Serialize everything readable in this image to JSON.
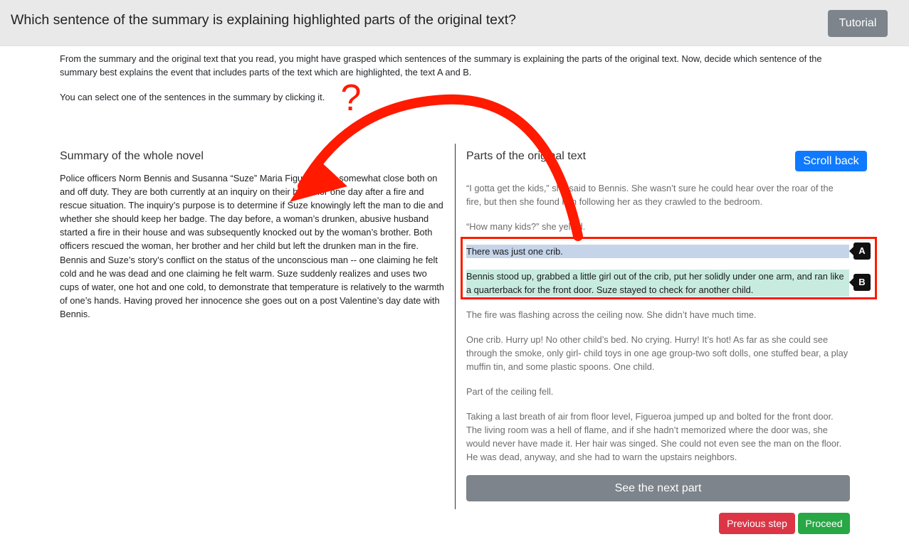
{
  "header": {
    "title": "Which sentence of the summary is explaining highlighted parts of the original text?",
    "tutorial_label": "Tutorial"
  },
  "instructions": {
    "line1": "From the summary and the original text that you read, you might have grasped which sentences of the summary is explaining the parts of the original text. Now, decide which sentence of the summary best explains the event that includes parts of the text which are highlighted, the text A and B.",
    "line2": "You can select one of the sentences in the summary by clicking it."
  },
  "summary": {
    "title": "Summary of the whole novel",
    "body": "Police officers Norm Bennis and Susanna “Suze” Maria Figueroa are somewhat close both on and off duty. They are both currently at an inquiry on their behavior one day after a fire and rescue situation. The inquiry’s purpose is to determine if Suze knowingly left the man to die and whether she should keep her badge. The day before, a woman’s drunken, abusive husband started a fire in their house and was subsequently knocked out by the woman’s brother. Both officers rescued the woman, her brother and her child but left the drunken man in the fire. Bennis and Suze’s story’s conflict on the status of the unconscious man -- one claiming he felt cold and he was dead and one claiming he felt warm. Suze suddenly realizes and uses two cups of water, one hot and one cold, to demonstrate that temperature is relatively to the warmth of one’s hands. Having proved her innocence she goes out on a post Valentine’s day date with Bennis."
  },
  "original": {
    "title": "Parts of the original text",
    "scroll_back_label": "Scroll back",
    "p1": "“I gotta get the kids,” she said to Bennis. She wasn’t sure he could hear over the roar of the fire, but then she found him following her as they crawled to the bedroom.",
    "p2": "“How many kids?” she yelled.",
    "pA": "There was just one crib.",
    "pB": "Bennis stood up, grabbed a little girl out of the crib, put her solidly under one arm, and ran like a quarterback for the front door. Suze stayed to check for another child.",
    "p3": "The fire was flashing across the ceiling now. She didn’t have much time.",
    "p4": "One crib. Hurry up! No other child’s bed. No crying. Hurry! It’s hot! As far as she could see through the smoke, only girl- child toys in one age group-two soft dolls, one stuffed bear, a play muffin tin, and some plastic spoons. One child.",
    "p5": "Part of the ceiling fell.",
    "p6": "Taking a last breath of air from floor level, Figueroa jumped up and bolted for the front door. The living room was a hell of flame, and if she hadn’t memorized where the door was, she would never have made it. Her hair was singed. She could not even see the man on the floor. He was dead, anyway, and she had to warn the upstairs neighbors.",
    "tag_a": "A",
    "tag_b": "B"
  },
  "buttons": {
    "next_part": "See the next part",
    "previous_step": "Previous step",
    "proceed": "Proceed"
  },
  "annotation": {
    "question_mark": "?",
    "color": "#ff1a00"
  }
}
